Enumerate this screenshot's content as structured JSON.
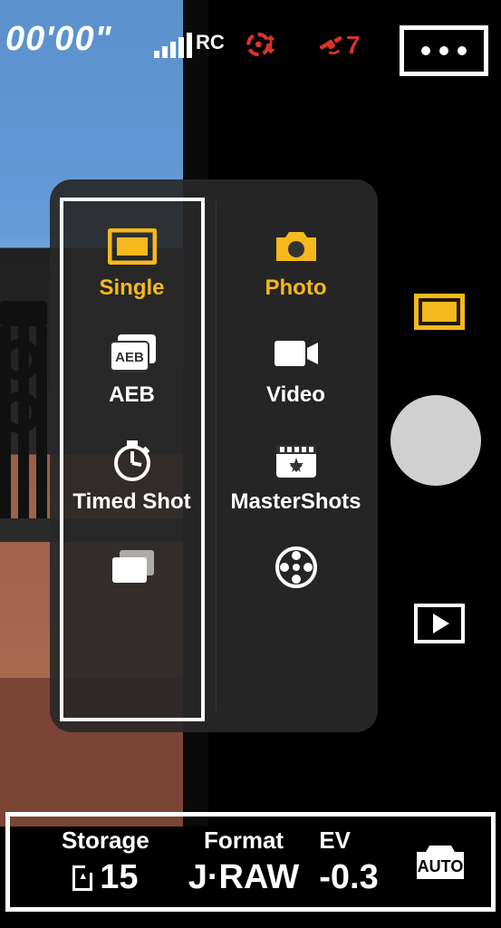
{
  "status": {
    "timer": "00'00\"",
    "rc_label": "RC",
    "sat_count": "7"
  },
  "panel": {
    "left": [
      {
        "id": "single",
        "label": "Single",
        "active": true
      },
      {
        "id": "aeb",
        "label": "AEB",
        "active": false
      },
      {
        "id": "timed",
        "label": "Timed Shot",
        "active": false
      },
      {
        "id": "burst",
        "label": "",
        "active": false
      }
    ],
    "right": [
      {
        "id": "photo",
        "label": "Photo",
        "active": true
      },
      {
        "id": "video",
        "label": "Video",
        "active": false
      },
      {
        "id": "mastershots",
        "label": "MasterShots",
        "active": false
      },
      {
        "id": "reel",
        "label": "",
        "active": false
      }
    ]
  },
  "bottom": {
    "storage_label": "Storage",
    "storage_value": "15",
    "format_label": "Format",
    "format_value": "J·RAW",
    "ev_label": "EV",
    "ev_value": "-0.3",
    "auto_label": "AUTO"
  }
}
